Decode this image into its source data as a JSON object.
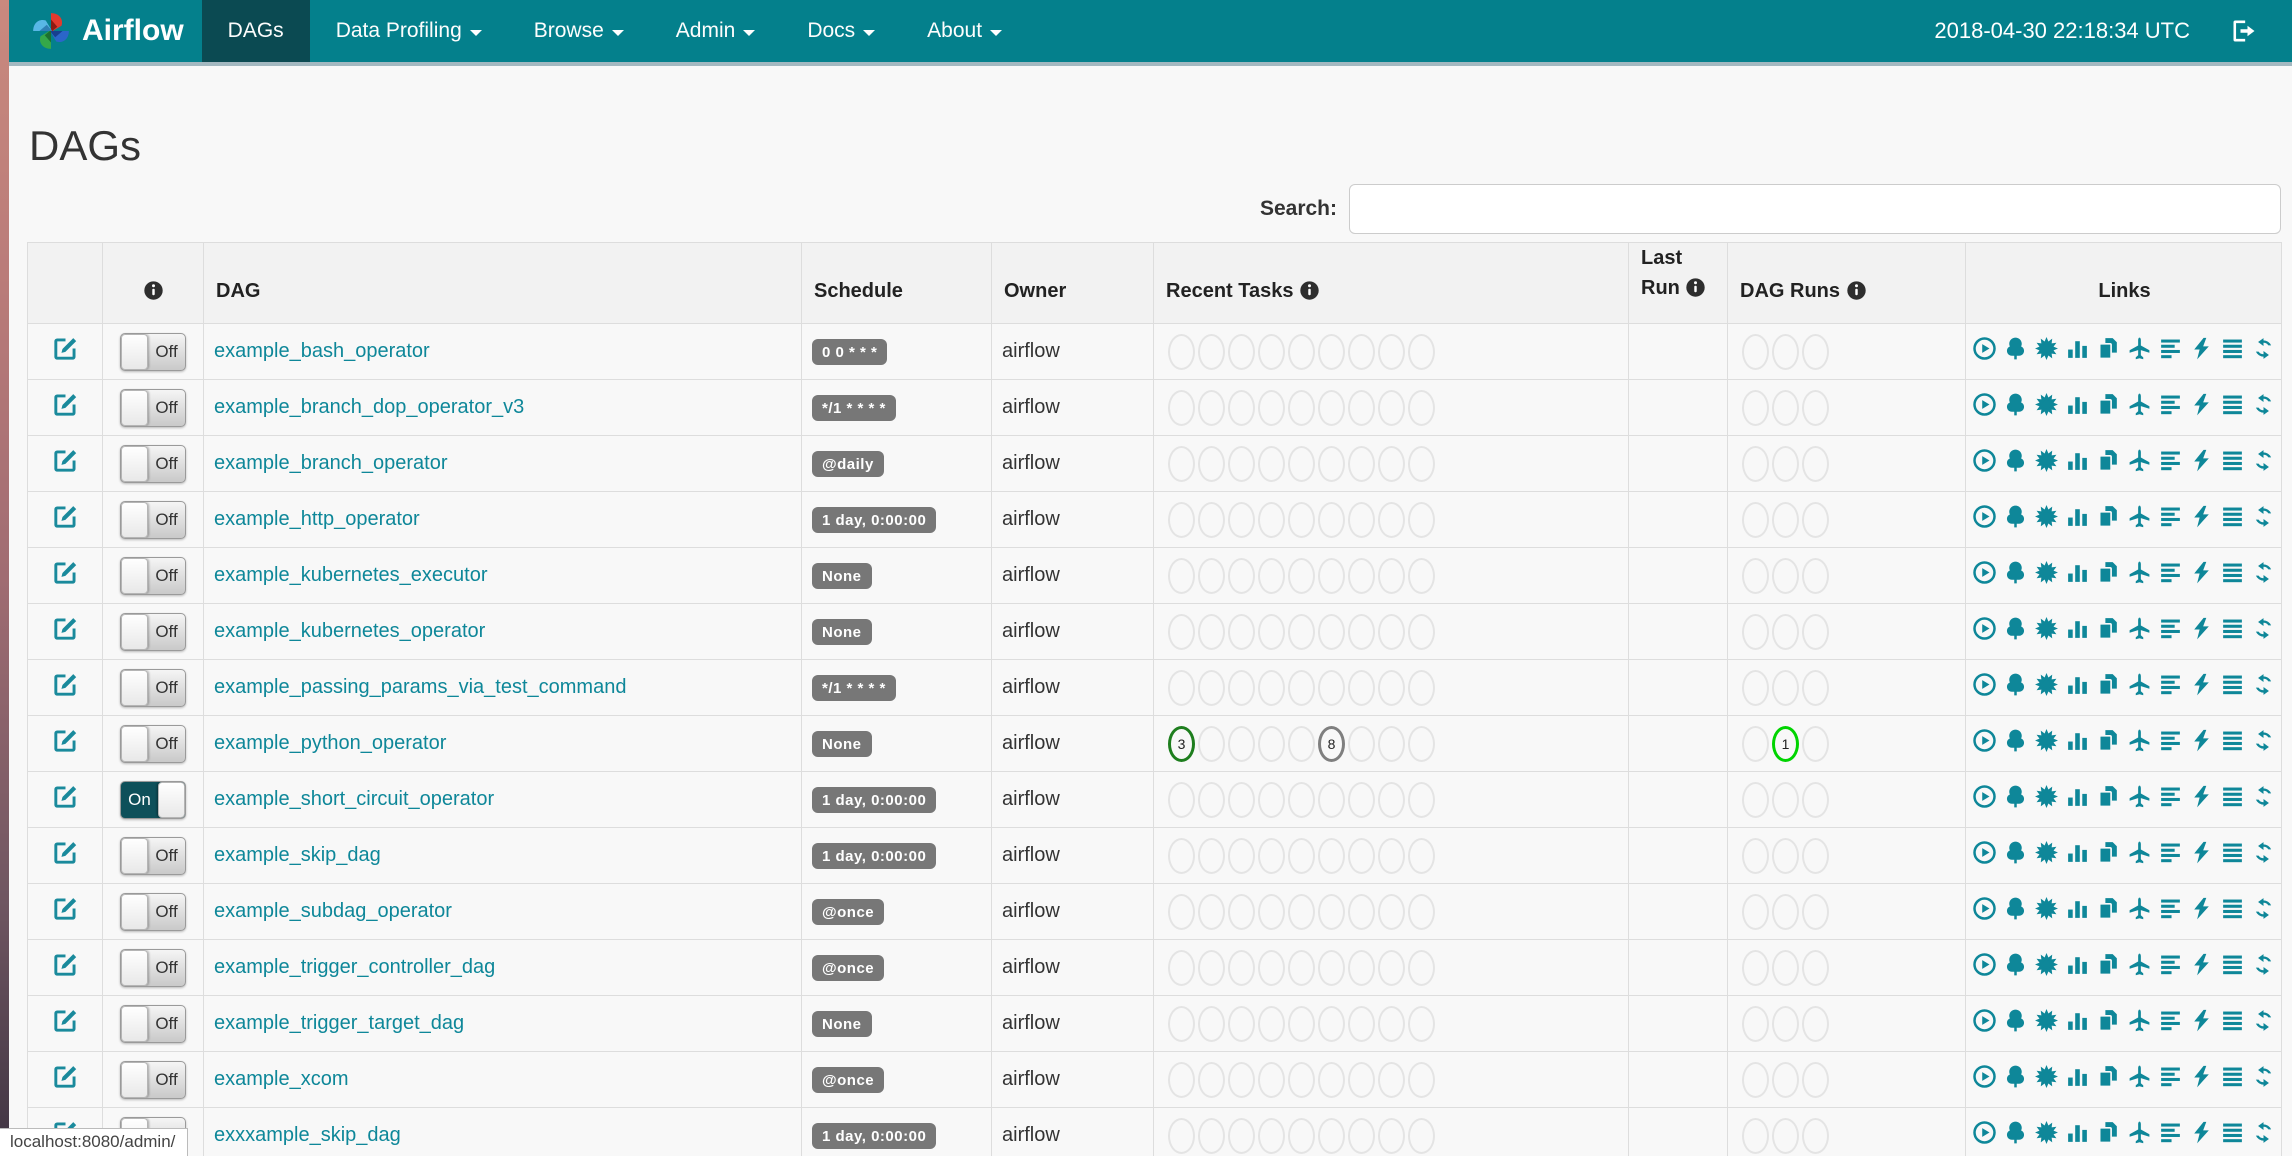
{
  "colors": {
    "navbar_bg": "#04808C",
    "navbar_active_bg": "#0B4A52",
    "accent": "#0E8799",
    "badge_bg": "#777777",
    "toggle_on_bg": "#0E505A",
    "states": {
      "success": "#1E7E1E",
      "queued": "#7F7F7F",
      "running": "#00D400",
      "empty": "#E4E4E4"
    }
  },
  "navbar": {
    "brand": "Airflow",
    "items": [
      {
        "label": "DAGs",
        "active": true,
        "caret": false
      },
      {
        "label": "Data Profiling",
        "active": false,
        "caret": true
      },
      {
        "label": "Browse",
        "active": false,
        "caret": true
      },
      {
        "label": "Admin",
        "active": false,
        "caret": true
      },
      {
        "label": "Docs",
        "active": false,
        "caret": true
      },
      {
        "label": "About",
        "active": false,
        "caret": true
      }
    ],
    "clock": "2018-04-30 22:18:34 UTC"
  },
  "page": {
    "title": "DAGs",
    "search_label": "Search:",
    "search_value": "",
    "status_bar": "localhost:8080/admin/"
  },
  "table": {
    "headers": {
      "dag": "DAG",
      "schedule": "Schedule",
      "owner": "Owner",
      "recent_tasks": "Recent Tasks",
      "last_run_line1": "Last",
      "last_run_line2": "Run",
      "dag_runs": "DAG Runs",
      "links": "Links"
    },
    "toggle_on_label": "On",
    "toggle_off_label": "Off",
    "recent_task_slots": 9,
    "dag_run_slots": 3,
    "rows": [
      {
        "name": "example_bash_operator",
        "schedule": "0 0 * * *",
        "owner": "airflow",
        "on": false,
        "recent_tasks": [],
        "dag_runs": []
      },
      {
        "name": "example_branch_dop_operator_v3",
        "schedule": "*/1 * * * *",
        "owner": "airflow",
        "on": false,
        "recent_tasks": [],
        "dag_runs": []
      },
      {
        "name": "example_branch_operator",
        "schedule": "@daily",
        "owner": "airflow",
        "on": false,
        "recent_tasks": [],
        "dag_runs": []
      },
      {
        "name": "example_http_operator",
        "schedule": "1 day, 0:00:00",
        "owner": "airflow",
        "on": false,
        "recent_tasks": [],
        "dag_runs": []
      },
      {
        "name": "example_kubernetes_executor",
        "schedule": "None",
        "owner": "airflow",
        "on": false,
        "recent_tasks": [],
        "dag_runs": []
      },
      {
        "name": "example_kubernetes_operator",
        "schedule": "None",
        "owner": "airflow",
        "on": false,
        "recent_tasks": [],
        "dag_runs": []
      },
      {
        "name": "example_passing_params_via_test_command",
        "schedule": "*/1 * * * *",
        "owner": "airflow",
        "on": false,
        "recent_tasks": [],
        "dag_runs": []
      },
      {
        "name": "example_python_operator",
        "schedule": "None",
        "owner": "airflow",
        "on": false,
        "recent_tasks": [
          {
            "slot": 0,
            "count": 3,
            "state": "success"
          },
          {
            "slot": 5,
            "count": 8,
            "state": "queued"
          }
        ],
        "dag_runs": [
          {
            "slot": 1,
            "count": 1,
            "state": "running"
          }
        ]
      },
      {
        "name": "example_short_circuit_operator",
        "schedule": "1 day, 0:00:00",
        "owner": "airflow",
        "on": true,
        "recent_tasks": [],
        "dag_runs": []
      },
      {
        "name": "example_skip_dag",
        "schedule": "1 day, 0:00:00",
        "owner": "airflow",
        "on": false,
        "recent_tasks": [],
        "dag_runs": []
      },
      {
        "name": "example_subdag_operator",
        "schedule": "@once",
        "owner": "airflow",
        "on": false,
        "recent_tasks": [],
        "dag_runs": []
      },
      {
        "name": "example_trigger_controller_dag",
        "schedule": "@once",
        "owner": "airflow",
        "on": false,
        "recent_tasks": [],
        "dag_runs": []
      },
      {
        "name": "example_trigger_target_dag",
        "schedule": "None",
        "owner": "airflow",
        "on": false,
        "recent_tasks": [],
        "dag_runs": []
      },
      {
        "name": "example_xcom",
        "schedule": "@once",
        "owner": "airflow",
        "on": false,
        "recent_tasks": [],
        "dag_runs": []
      },
      {
        "name": "exxxample_skip_dag",
        "schedule": "1 day, 0:00:00",
        "owner": "airflow",
        "on": false,
        "recent_tasks": [],
        "dag_runs": []
      }
    ]
  },
  "links": [
    {
      "name": "trigger-dag",
      "icon": "play-circle"
    },
    {
      "name": "tree-view",
      "icon": "tree"
    },
    {
      "name": "graph-view",
      "icon": "sunburst"
    },
    {
      "name": "task-duration",
      "icon": "bar-chart"
    },
    {
      "name": "task-tries",
      "icon": "copy"
    },
    {
      "name": "landing-times",
      "icon": "plane"
    },
    {
      "name": "gantt-view",
      "icon": "align-left"
    },
    {
      "name": "code-view",
      "icon": "bolt"
    },
    {
      "name": "logs",
      "icon": "align-justify"
    },
    {
      "name": "refresh",
      "icon": "refresh"
    }
  ]
}
